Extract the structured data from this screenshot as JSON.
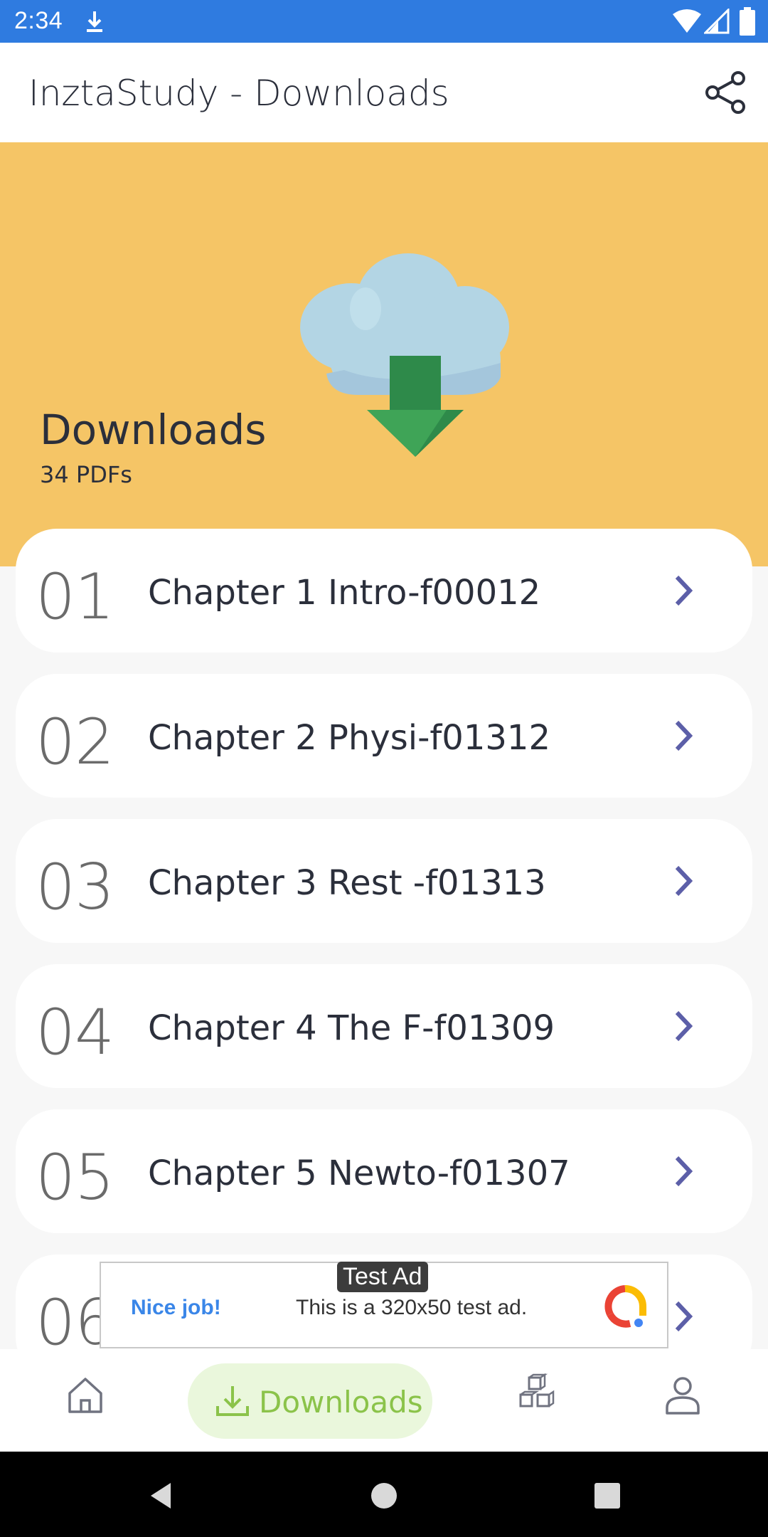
{
  "status_bar": {
    "time": "2:34"
  },
  "app_bar": {
    "title": "InztaStudy - Downloads",
    "share_icon": "share-icon"
  },
  "hero": {
    "title": "Downloads",
    "subtitle": "34 PDFs",
    "illustration": "cloud-download-icon",
    "background_color": "#f5c566"
  },
  "downloads": [
    {
      "index": "01",
      "name": "Chapter 1 Intro-f00012"
    },
    {
      "index": "02",
      "name": "Chapter 2 Physi-f01312"
    },
    {
      "index": "03",
      "name": "Chapter 3 Rest -f01313"
    },
    {
      "index": "04",
      "name": "Chapter 4 The F-f01309"
    },
    {
      "index": "05",
      "name": "Chapter 5 Newto-f01307"
    },
    {
      "index": "06",
      "name": ""
    }
  ],
  "ad": {
    "tag": "Test Ad",
    "headline": "Nice job!",
    "text": "This is a 320x50 test ad."
  },
  "bottom_nav": {
    "items": [
      {
        "icon": "home-icon",
        "label": ""
      },
      {
        "icon": "download-icon",
        "label": "Downloads",
        "active": true
      },
      {
        "icon": "cubes-icon",
        "label": ""
      },
      {
        "icon": "user-icon",
        "label": ""
      }
    ],
    "active_color": "#8bc34a"
  },
  "colors": {
    "status_bar": "#2f7be0",
    "chevron": "#5c5fa8"
  }
}
